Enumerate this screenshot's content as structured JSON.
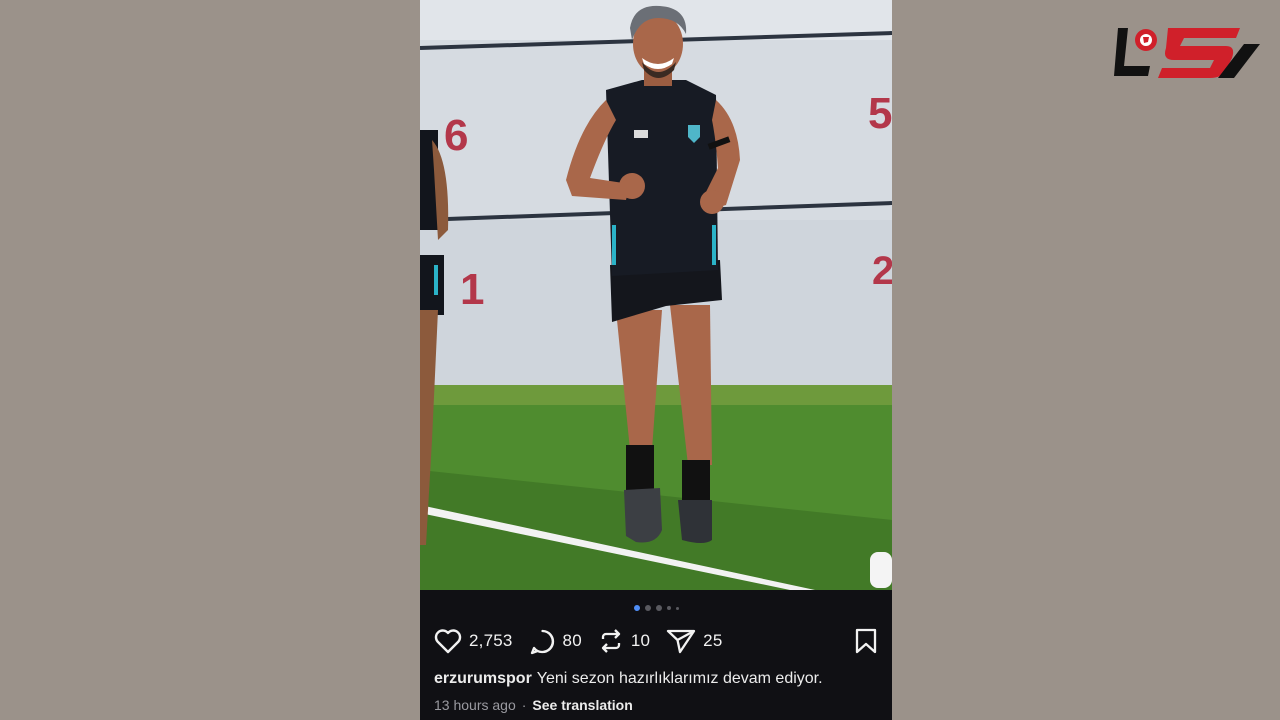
{
  "brand": {
    "logo_icon": "brand-logo",
    "colors": {
      "red": "#d0202a",
      "black": "#111111"
    }
  },
  "post": {
    "photo": {
      "wall_numbers": [
        "6",
        "5",
        "1",
        "2"
      ],
      "description_icon": "player-jogging-photo"
    },
    "carousel": {
      "count": 5,
      "active_index": 0,
      "active_color": "#4f8ef7"
    },
    "actions": {
      "likes": "2,753",
      "comments": "80",
      "reposts": "10",
      "shares": "25",
      "icons": [
        "heart-icon",
        "comment-icon",
        "repost-icon",
        "send-icon",
        "bookmark-icon"
      ]
    },
    "caption": {
      "username": "erzurumspor",
      "text": "Yeni sezon hazırlıklarımız devam ediyor."
    },
    "meta": {
      "time": "13 hours ago",
      "separator": "·",
      "translate": "See translation"
    }
  },
  "colors": {
    "background": "#9b928a",
    "panel": "#101014",
    "grass": "#4e8a2e",
    "wall": "#d9dde2"
  }
}
